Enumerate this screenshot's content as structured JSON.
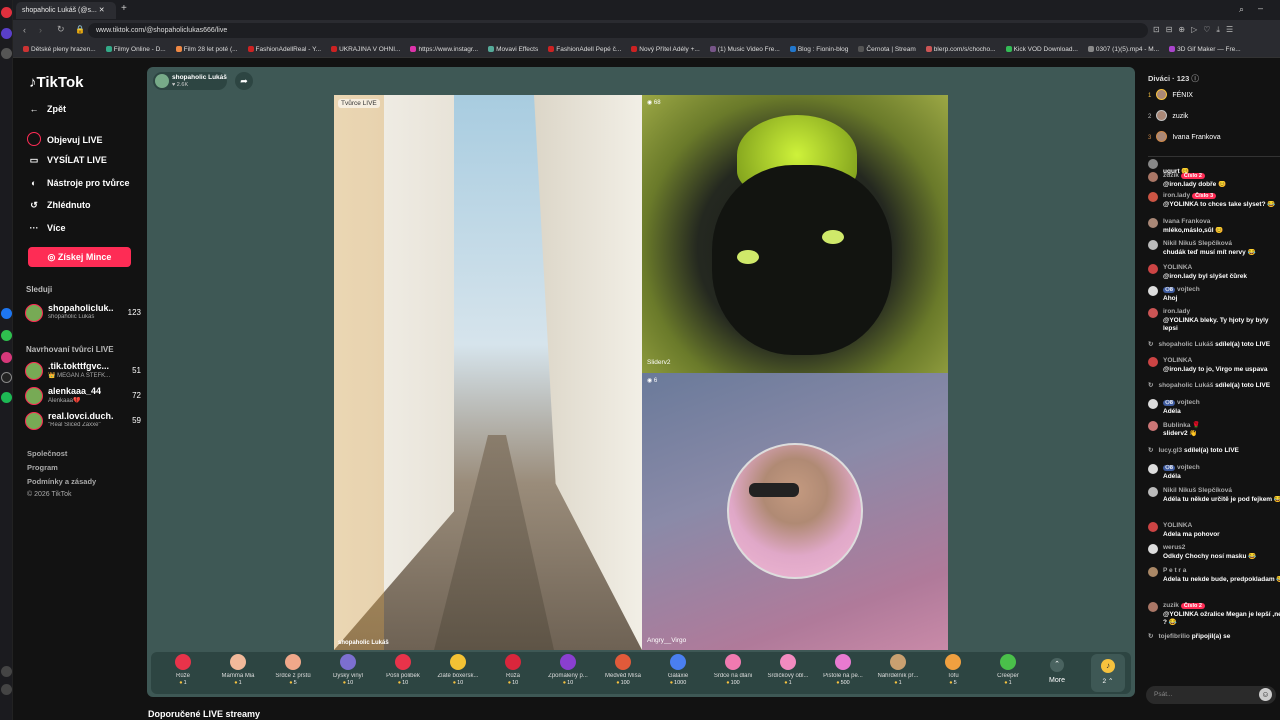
{
  "browser": {
    "tab_title": "shopaholic Lukáš (@s...",
    "url": "www.tiktok.com/@shopaholiclukas666/live",
    "bookmarks": [
      "Dětské pleny hrazen...",
      "Filmy Online - D...",
      "Film 28 let poté (...",
      "FashionAdellReal - Y...",
      "UKRAJINA V OHNI...",
      "https://www.instagr...",
      "Movavi Effects",
      "FashionAdell Pepé č...",
      "Nový Přítel Adély +...",
      "(1) Music Video Fre...",
      "Blog : Fionin-blog",
      "Černota | Stream",
      "blerp.com/s/chocho...",
      "Kick VOD Download...",
      "0307 (1)(5).mp4 - M...",
      "3D Gif Maker — Fre..."
    ]
  },
  "nav": {
    "logo": "TikTok",
    "back": "Zpět",
    "explore_live": "Objevuj LIVE",
    "go_live": "VYSÍLAT LIVE",
    "creator_tools": "Nástroje pro tvůrce",
    "watched": "Zhlédnuto",
    "more": "Více",
    "coins_button": "Získej Mince",
    "following_title": "Sleduji",
    "following": [
      {
        "name": "shopaholicluk...",
        "sub": "shopaholic Lukáš",
        "count": "123"
      }
    ],
    "suggested_title": "Navrhovaní tvůrci LIVE",
    "suggested": [
      {
        "name": ".tik.tokttfgvc...",
        "sub": "👑 MEGAN A ŠTEFK...",
        "count": "51"
      },
      {
        "name": "alenkaaa_44",
        "sub": "Alenkaaa💔",
        "count": "72"
      },
      {
        "name": "real.lovci.duch...",
        "sub": "\"Real Sliced Zaxxe\"",
        "count": "59"
      }
    ],
    "footer": [
      "Společnost",
      "Program",
      "Podmínky a zásady",
      "© 2026 TikTok"
    ]
  },
  "stream": {
    "host_name": "shopaholic Lukáš",
    "host_likes": "2.6K",
    "main_label": "Tvůrce LIVE",
    "main_caption": "shopaholic Lukáš",
    "guest1_count": "68",
    "guest1_name": "Sliderv2",
    "guest2_count": "6",
    "guest2_name": "Angry__Virgo",
    "recommended_title": "Doporučené LIVE streamy",
    "more_label": "More",
    "coin_count": "2"
  },
  "gifts": [
    {
      "label": "Růže",
      "price": "1",
      "color": "#e8334a"
    },
    {
      "label": "Mamma Mia",
      "price": "1",
      "color": "#f1b99a"
    },
    {
      "label": "Srdce z prstů",
      "price": "5",
      "color": "#f0a88a"
    },
    {
      "label": "Dyský vinyl",
      "price": "10",
      "color": "#7c6fd0"
    },
    {
      "label": "Pošli polibek",
      "price": "10",
      "color": "#e8334a"
    },
    {
      "label": "Zlaté boxersk...",
      "price": "10",
      "color": "#f3c234"
    },
    {
      "label": "Růža",
      "price": "10",
      "color": "#d9263c"
    },
    {
      "label": "Zpomalený p...",
      "price": "10",
      "color": "#8a3fd0"
    },
    {
      "label": "Medvěd Míša",
      "price": "100",
      "color": "#e05a3a"
    },
    {
      "label": "Galaxie",
      "price": "1000",
      "color": "#4a7ff0"
    },
    {
      "label": "Srdce na dlani",
      "price": "100",
      "color": "#f07ab0"
    },
    {
      "label": "Srdíčkový obl...",
      "price": "1",
      "color": "#f28bc0"
    },
    {
      "label": "Pistole na pe...",
      "price": "500",
      "color": "#e87ad0"
    },
    {
      "label": "Náhrdelník př...",
      "price": "1",
      "color": "#c9a070"
    },
    {
      "label": "Tofu",
      "price": "5",
      "color": "#f0a040"
    },
    {
      "label": "Creeper",
      "price": "1",
      "color": "#4ac04a"
    }
  ],
  "viewers": {
    "title": "Diváci · 123",
    "top": [
      {
        "rank": "1",
        "name": "FÉNIX"
      },
      {
        "rank": "2",
        "name": "zuzik"
      },
      {
        "rank": "3",
        "name": "Ivana Frankova"
      }
    ]
  },
  "chat": [
    {
      "user": "",
      "text": "ugurt 😊",
      "badge": ""
    },
    {
      "user": "zuzik",
      "text": "@iron.lady dobře 😊",
      "badge": "Číslo 2"
    },
    {
      "user": "iron.lady",
      "text": "@YOLINKA to chces take slyset? 😂",
      "badge": "Číslo 3"
    },
    {
      "user": "Ivana Frankova",
      "text": "mléko,máslo,sůl 😊",
      "badge": ""
    },
    {
      "user": "Nikil Nikuš Slepčíková",
      "text": "chudák teď musí mít nervy 😂",
      "badge": ""
    },
    {
      "user": "YOLINKA",
      "text": "@iron.lady byl slyšet čůrek",
      "badge": ""
    },
    {
      "user": "vojtech",
      "text": "Ahoj",
      "badge": ""
    },
    {
      "user": "iron.lady",
      "text": "@YOLINKA bleky. Ty hjoty by byly lepsi",
      "badge": ""
    },
    {
      "user": "YOLINKA",
      "text": "@iron.lady to jo, Virgo me uspava",
      "badge": ""
    },
    {
      "user": "vojtech",
      "text": "Adéla",
      "badge": ""
    },
    {
      "user": "Bublinka 🌹",
      "text": "sliderv2 👋",
      "badge": ""
    },
    {
      "user": "vojtech",
      "text": "Adéla",
      "badge": ""
    },
    {
      "user": "Nikil Nikuš Slepčíková",
      "text": "Adéla tu někde určitě je pod fejkem 😂",
      "badge": ""
    },
    {
      "user": "YOLINKA",
      "text": "Adela ma pohovor",
      "badge": ""
    },
    {
      "user": "werus2",
      "text": "Odkdy Chochy nosí masku 😂",
      "badge": ""
    },
    {
      "user": "P e t r a",
      "text": "Adela tu nekde bude, predpokladam 😂",
      "badge": ""
    },
    {
      "user": "zuzik",
      "text": "@YOLINKA ožralice Megan je lepší ,ne ? 😂",
      "badge": "Číslo 2"
    }
  ],
  "shares": [
    {
      "user": "shopaholic Lukáš",
      "action": "sdílel(a) toto LIVE"
    },
    {
      "user": "shopaholic Lukáš",
      "action": "sdílel(a) toto LIVE"
    },
    {
      "user": "lucy.gl3",
      "action": "sdílel(a) toto LIVE"
    },
    {
      "user": "tojefibrilio",
      "action": "připojil(a) se"
    }
  ],
  "chat_input": {
    "placeholder": "Psát..."
  }
}
